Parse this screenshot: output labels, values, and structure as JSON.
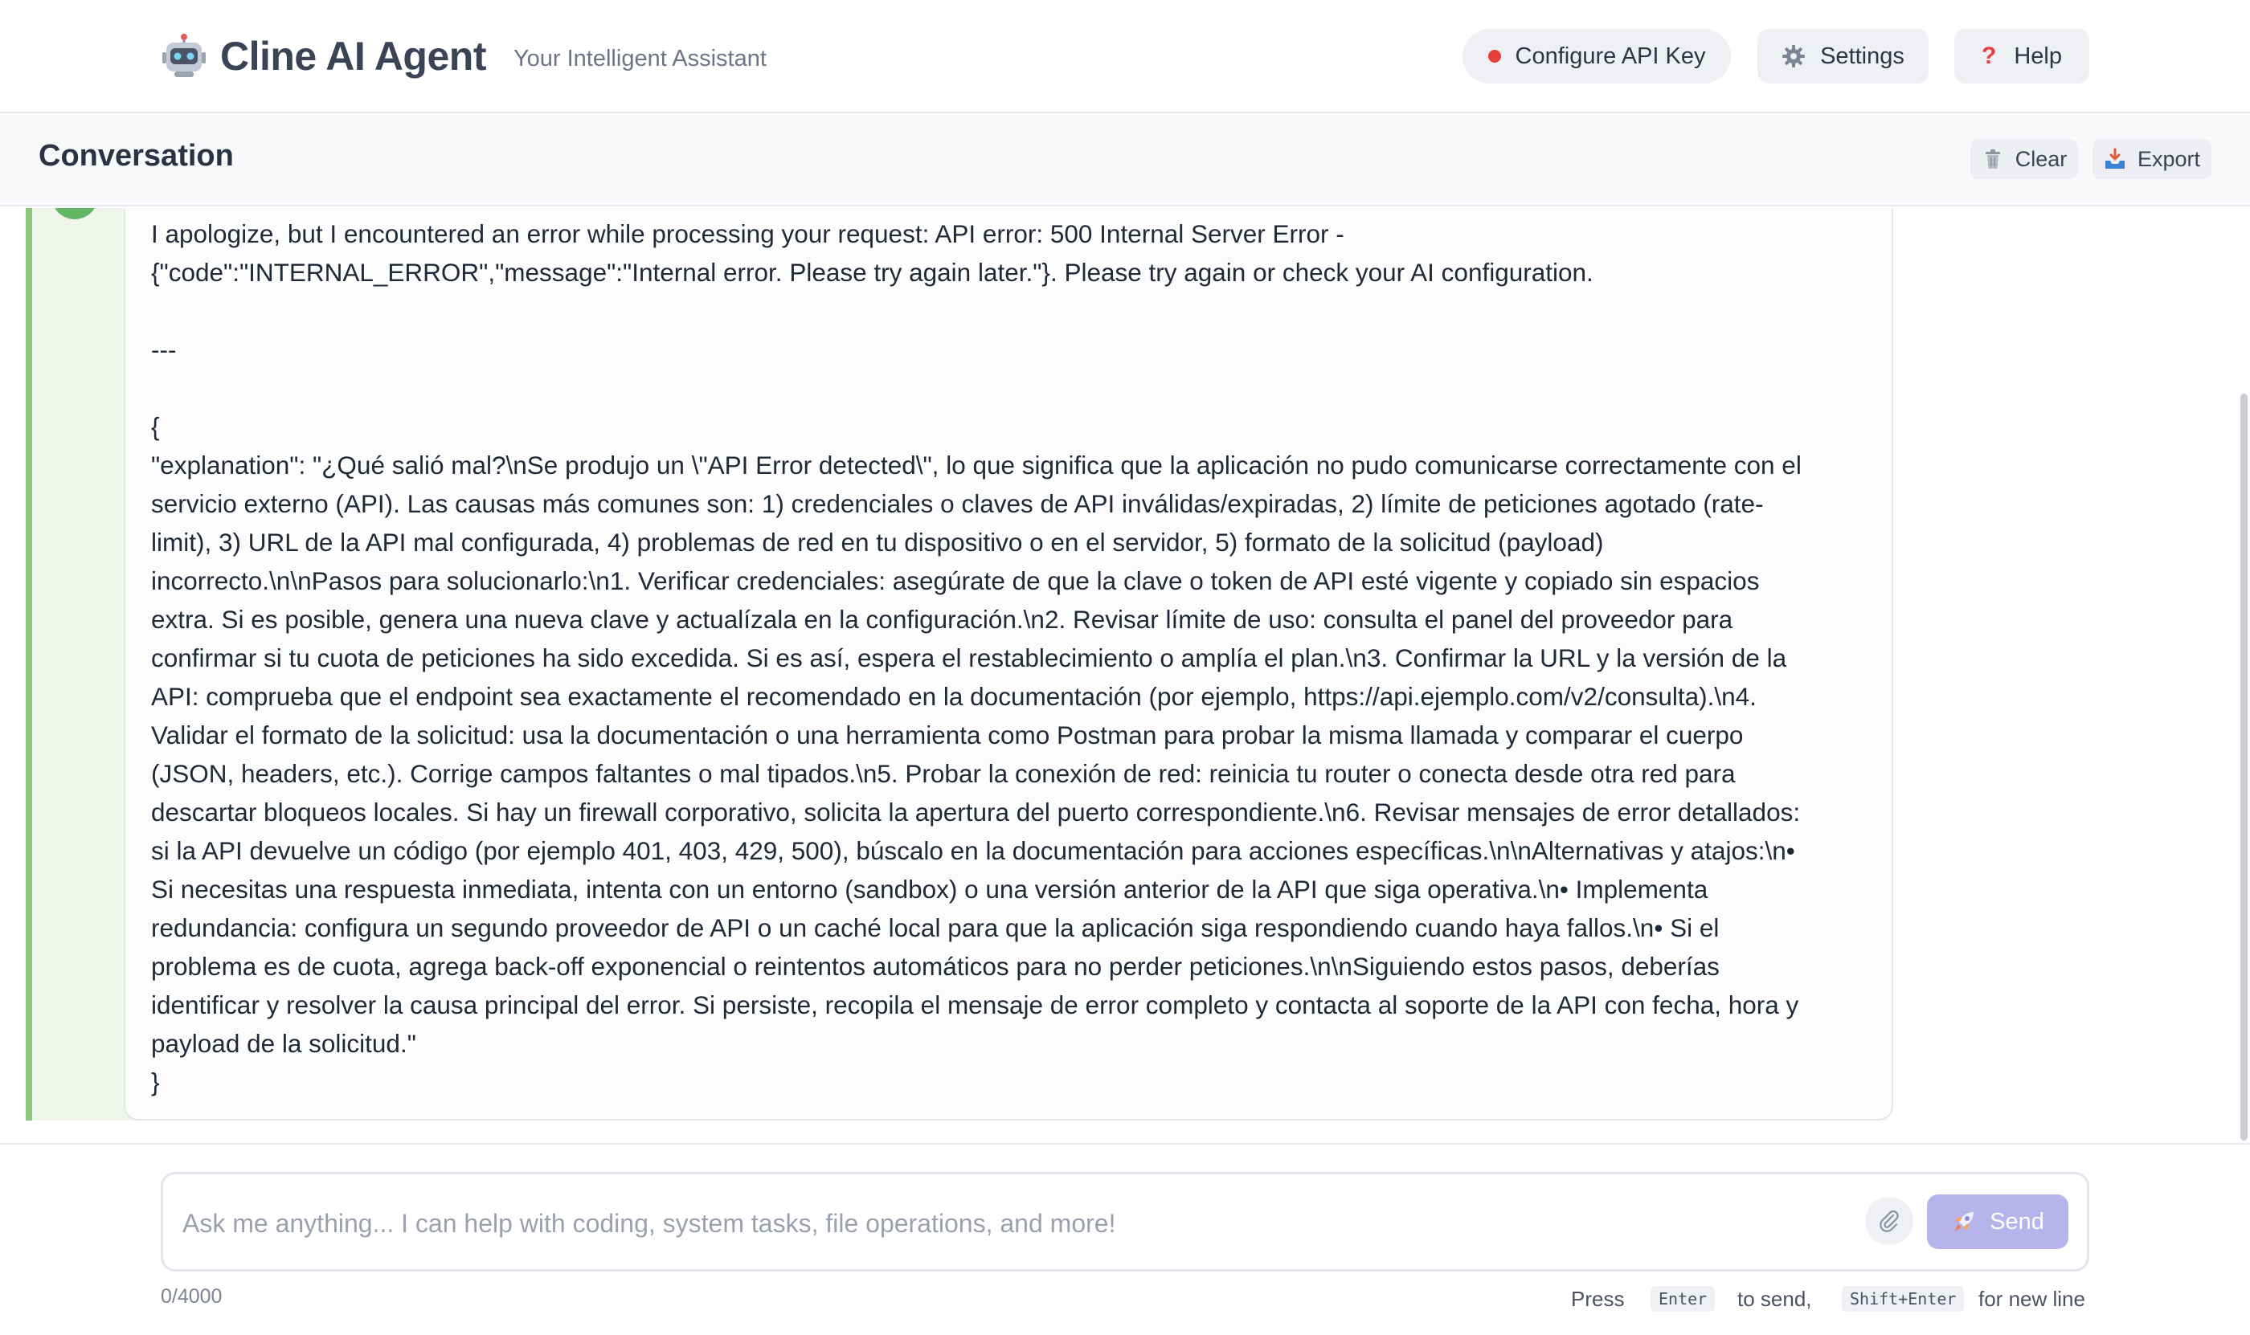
{
  "header": {
    "brand_emoji": "🤖",
    "brand_icon": "robot-icon",
    "title": "Cline AI Agent",
    "subtitle": "Your Intelligent Assistant",
    "buttons": {
      "api_key": "Configure API Key",
      "settings": "Settings",
      "help": "Help"
    },
    "api_status_color": "#e53e3e"
  },
  "conversation": {
    "title": "Conversation",
    "clear_label": "Clear",
    "export_label": "Export"
  },
  "message": {
    "lines": [
      "I apologize, but I encountered an error while processing your request: API error: 500 Internal Server Error -",
      "{\"code\":\"INTERNAL_ERROR\",\"message\":\"Internal error. Please try again later.\"}. Please try again or check your AI configuration.",
      "",
      "---",
      "",
      "{",
      "\"explanation\": \"¿Qué salió mal?\\nSe produjo un \\\"API Error detected\\\", lo que significa que la aplicación no pudo comunicarse correctamente con el",
      "servicio externo (API). Las causas más comunes son: 1) credenciales o claves de API inválidas/expiradas, 2) límite de peticiones agotado (rate-",
      "limit), 3) URL de la API mal configurada, 4) problemas de red en tu dispositivo o en el servidor, 5) formato de la solicitud (payload)",
      "incorrecto.\\n\\nPasos para solucionarlo:\\n1. Verificar credenciales: asegúrate de que la clave o token de API esté vigente y copiado sin espacios",
      "extra. Si es posible, genera una nueva clave y actualízala en la configuración.\\n2. Revisar límite de uso: consulta el panel del proveedor para",
      "confirmar si tu cuota de peticiones ha sido excedida. Si es así, espera el restablecimiento o amplía el plan.\\n3. Confirmar la URL y la versión de la",
      "API: comprueba que el endpoint sea exactamente el recomendado en la documentación (por ejemplo, https://api.ejemplo.com/v2/consulta).\\n4.",
      "Validar el formato de la solicitud: usa la documentación o una herramienta como Postman para probar la misma llamada y comparar el cuerpo",
      "(JSON, headers, etc.). Corrige campos faltantes o mal tipados.\\n5. Probar la conexión de red: reinicia tu router o conecta desde otra red para",
      "descartar bloqueos locales. Si hay un firewall corporativo, solicita la apertura del puerto correspondiente.\\n6. Revisar mensajes de error detallados:",
      "si la API devuelve un código (por ejemplo 401, 403, 429, 500), búscalo en la documentación para acciones específicas.\\n\\nAlternativas y atajos:\\n•",
      "Si necesitas una respuesta inmediata, intenta con un entorno (sandbox) o una versión anterior de la API que siga operativa.\\n• Implementa",
      "redundancia: configura un segundo proveedor de API o un caché local para que la aplicación siga respondiendo cuando haya fallos.\\n• Si el",
      "problema es de cuota, agrega back-off exponencial o reintentos automáticos para no perder peticiones.\\n\\nSiguiendo estos pasos, deberías",
      "identificar y resolver la causa principal del error. Si persiste, recopila el mensaje de error completo y contacta al soporte de la API con fecha, hora y",
      "payload de la solicitud.\"",
      "}"
    ]
  },
  "input": {
    "placeholder": "Ask me anything... I can help with coding, system tasks, file operations, and more!",
    "value": "",
    "send_label": "Send",
    "char_count": "0/4000",
    "hint_press": "Press",
    "hint_enter_key": "Enter",
    "hint_to_send": "to send,",
    "hint_newline_key": "Shift+Enter",
    "hint_for_new_line": "for new line"
  },
  "colors": {
    "accent_green": "#8cc97c",
    "send_button": "#b7b4ec"
  }
}
